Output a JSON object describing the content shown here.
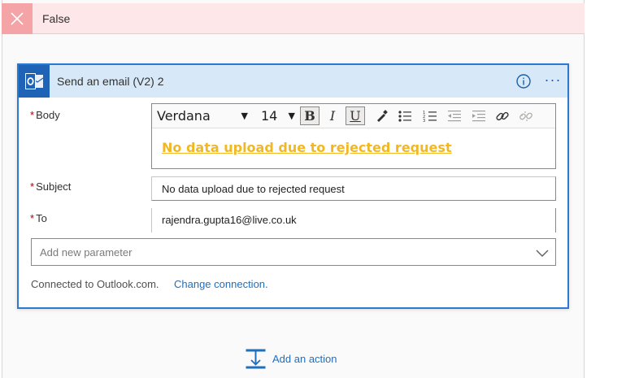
{
  "branch": {
    "title": "False"
  },
  "card": {
    "title": "Send an email (V2) 2",
    "fields": {
      "body": {
        "label": "Body",
        "font": "Verdana",
        "size": "14",
        "content": "No data upload due to rejected request"
      },
      "subject": {
        "label": "Subject",
        "value": "No data upload due to rejected request"
      },
      "to": {
        "label": "To",
        "value": "rajendra.gupta16@live.co.uk"
      }
    },
    "required_marker": "*",
    "add_parameter_placeholder": "Add new parameter",
    "connection": {
      "text": "Connected to Outlook.com.",
      "link": "Change connection."
    }
  },
  "add_action": {
    "label": "Add an action"
  },
  "colors": {
    "accent": "#2b79d0",
    "header_bg": "#d7e9f8",
    "branch_bg": "#fde7e9",
    "body_text": "#f2b824",
    "link": "#1f6fbd"
  }
}
